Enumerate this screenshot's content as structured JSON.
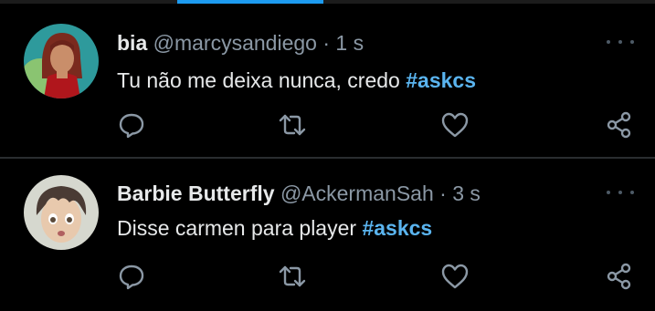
{
  "tweets": [
    {
      "name": "bia",
      "handle": "@marcysandiego",
      "separator": "·",
      "time": "1 s",
      "text": "Tu não me deixa nunca, credo",
      "hashtag": "#askcs"
    },
    {
      "name": "Barbie Butterfly",
      "handle": "@AckermanSah",
      "separator": "·",
      "time": "3 s",
      "text": "Disse carmen para player",
      "hashtag": "#askcs"
    }
  ],
  "icons": {
    "reply": "reply-icon",
    "retweet": "retweet-icon",
    "like": "like-icon",
    "share": "share-icon",
    "more": "more-icon"
  },
  "colors": {
    "background": "#000000",
    "text": "#e7e9ea",
    "secondary": "#8b98a5",
    "hashtag": "#5ab4ef",
    "accent": "#1d9bf0"
  }
}
